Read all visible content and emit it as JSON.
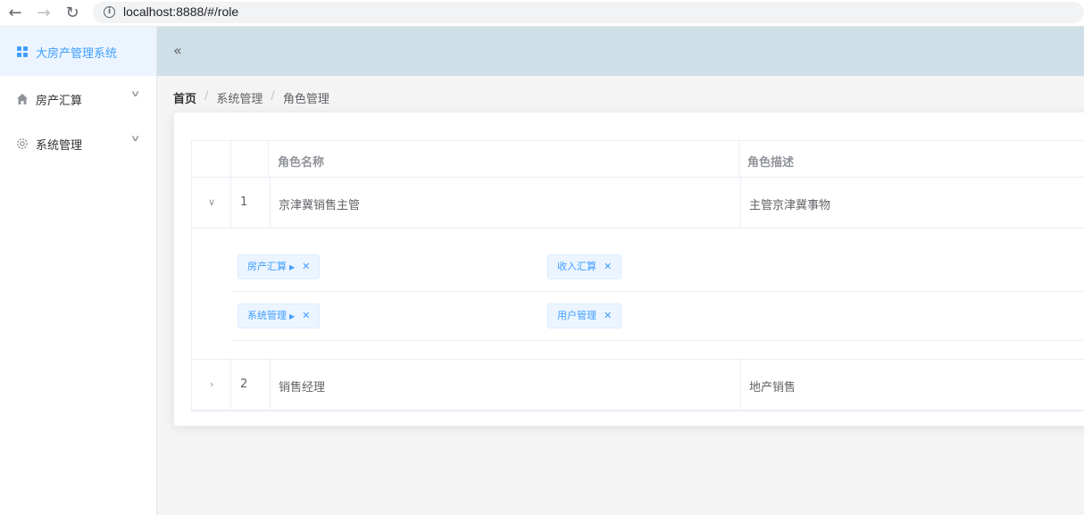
{
  "browser": {
    "url": "localhost:8888/#/role"
  },
  "sidebar": {
    "brand": "大房产管理系统",
    "items": [
      {
        "label": "房产汇算",
        "icon": "home-icon"
      },
      {
        "label": "系统管理",
        "icon": "gear-icon"
      }
    ]
  },
  "header": {
    "collapse_icon": "double-chevron-left-icon"
  },
  "breadcrumb": [
    "首页",
    "系统管理",
    "角色管理"
  ],
  "table": {
    "columns": [
      "",
      "",
      "角色名称",
      "角色描述"
    ],
    "rows": [
      {
        "index": "1",
        "name": "京津冀销售主管",
        "description": "主管京津冀事物",
        "expanded": true,
        "permissions": [
          {
            "level1": "房产汇算",
            "level2": [
              "收入汇算"
            ]
          },
          {
            "level1": "系统管理",
            "level2": [
              "用户管理"
            ]
          }
        ]
      },
      {
        "index": "2",
        "name": "销售经理",
        "description": "地产销售",
        "expanded": false
      }
    ]
  },
  "colors": {
    "accent": "#409eff",
    "header_bg": "#cfdfe8",
    "tag_bg": "#ecf5ff"
  }
}
